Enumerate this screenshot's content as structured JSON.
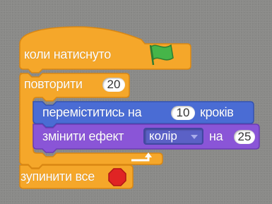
{
  "blocks": {
    "hat": {
      "label": "коли натиснуто",
      "icon": "green-flag-icon"
    },
    "repeat": {
      "label": "повторити",
      "count": "20"
    },
    "move": {
      "label_before": "переміститись на",
      "steps": "10",
      "label_after": "кроків"
    },
    "effect": {
      "label": "змінити ефект",
      "effect_option": "колір",
      "label_mid": "на",
      "amount": "25",
      "icon": "dropdown-arrow-icon"
    },
    "stop": {
      "label": "зупинити все",
      "icon": "stop-sign-icon"
    }
  },
  "colors": {
    "control": "#f5a72a",
    "control_dark": "#d98713",
    "motion": "#4a6cd4",
    "looks": "#8a55d7",
    "background": "#8a8a88",
    "flag": "#46b549",
    "stop": "#e02424"
  }
}
